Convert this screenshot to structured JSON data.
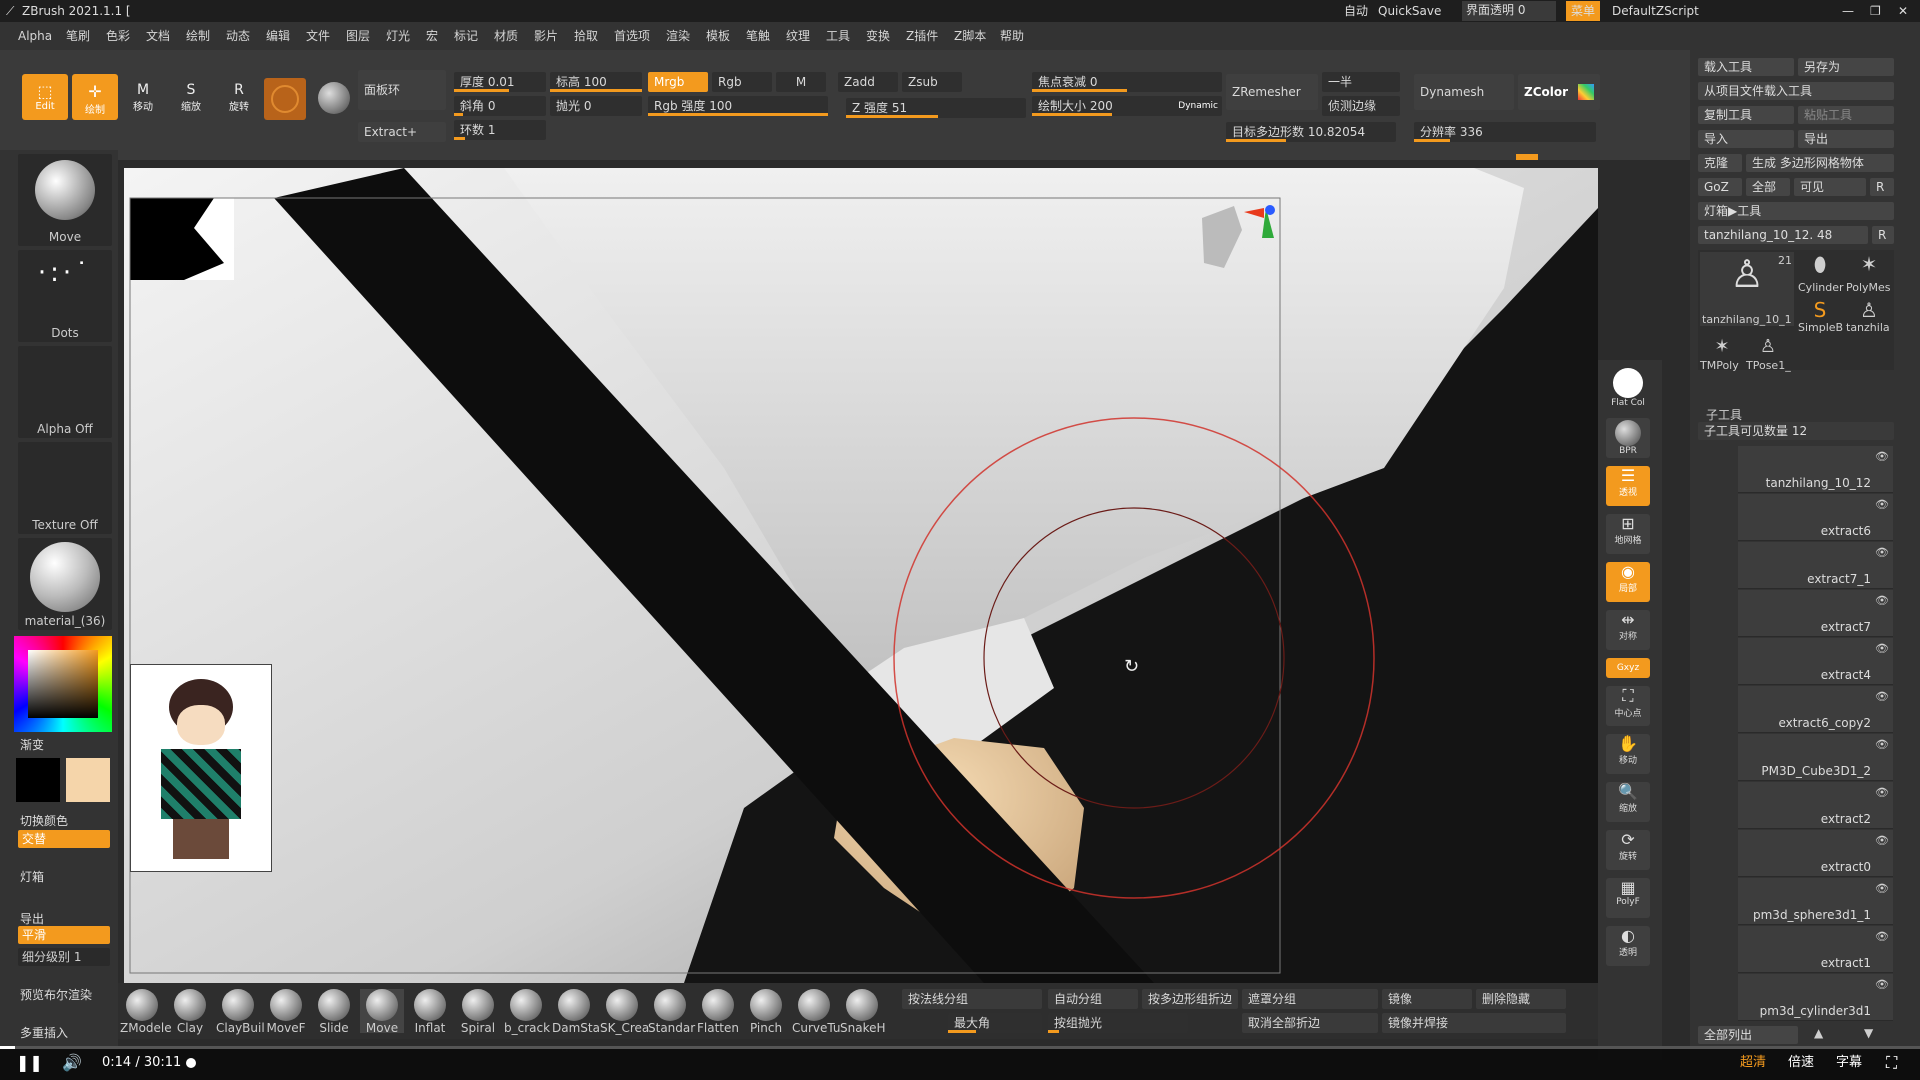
{
  "app": {
    "title": "ZBrush 2021.1.1 [",
    "top_right": {
      "auto": "自动",
      "quicksave": "QuickSave",
      "ui_transparency": "界面透明 0",
      "menus": "菜单",
      "script": "DefaultZScript"
    }
  },
  "menu": [
    "Alpha",
    "笔刷",
    "色彩",
    "文档",
    "绘制",
    "动态",
    "编辑",
    "文件",
    "图层",
    "灯光",
    "宏",
    "标记",
    "材质",
    "影片",
    "拾取",
    "首选项",
    "渲染",
    "模板",
    "笔触",
    "纹理",
    "工具",
    "变换",
    "Z插件",
    "Z脚本",
    "帮助"
  ],
  "toolbar": {
    "edit": "Edit",
    "draw": "绘制",
    "move": "移动",
    "scale": "缩放",
    "rotate": "旋转",
    "panel_loops": "面板环",
    "extract": "Extract+",
    "thickness": "厚度 0.01",
    "bevel": "斜角 0",
    "loops": "环数 1",
    "elevation": "标高 100",
    "polish": "抛光 0",
    "mrgb": "Mrgb",
    "rgb": "Rgb",
    "m": "M",
    "rgb_intensity": "Rgb 强度 100",
    "zadd": "Zadd",
    "zsub": "Zsub",
    "z_intensity": "Z 强度 51",
    "focal_shift": "焦点衰减 0",
    "draw_size": "绘制大小 200",
    "dynamic": "Dynamic",
    "zremesher": "ZRemesher",
    "half": "一半",
    "detect_edges": "侦测边缘",
    "target_poly": "目标多边形数 10.82054",
    "dynamesh": "Dynamesh",
    "resolution": "分辨率 336",
    "zcolor": "ZColor"
  },
  "left": {
    "brush": "Move",
    "stroke": "Dots",
    "alpha": "Alpha Off",
    "texture": "Texture Off",
    "material": "material_(36)",
    "gradient": "渐变",
    "switch_color": "切换颜色",
    "alternate": "交替",
    "lightbox": "灯箱",
    "export": "导出",
    "smooth": "平滑",
    "subdiv": "细分级别 1",
    "preview_bool": "预览布尔渲染",
    "multi_insert": "多重插入"
  },
  "colors": {
    "accent": "#f39a1e",
    "secondary": "#f5d5aa",
    "main": "#111111"
  },
  "shelf": [
    {
      "label": "Flat Col",
      "icon": "white-sphere-icon"
    },
    {
      "label": "BPR",
      "icon": "bpr-icon"
    },
    {
      "label": "透视",
      "icon": "perspective-icon",
      "on": true
    },
    {
      "label": "地网格",
      "icon": "floor-icon"
    },
    {
      "label": "局部",
      "icon": "local-icon",
      "on": true
    },
    {
      "label": "对称",
      "icon": "symmetry-icon"
    },
    {
      "label": "Gxyz",
      "icon": "xyz-icon",
      "on": true
    },
    {
      "label": "中心点",
      "icon": "frame-icon"
    },
    {
      "label": "移动",
      "icon": "move-icon"
    },
    {
      "label": "缩放",
      "icon": "zoom-icon"
    },
    {
      "label": "旋转",
      "icon": "rotate-icon"
    },
    {
      "label": "PolyF",
      "icon": "polyframe-icon"
    },
    {
      "label": "透明",
      "icon": "transparency-icon"
    }
  ],
  "right": {
    "load_tool": "载入工具",
    "save_as": "另存为",
    "load_from_project": "从项目文件载入工具",
    "copy_tool": "复制工具",
    "paste_tool": "粘贴工具",
    "import": "导入",
    "export": "导出",
    "clone": "克隆",
    "make_polymesh": "生成 多边形网格物体",
    "goz": "GoZ",
    "all": "全部",
    "visible": "可见",
    "r": "R",
    "lightbox_tools": "灯箱▶工具",
    "current_tool": "tanzhilang_10_12. 48",
    "tools": [
      "tanzhilang_10_1",
      "Cylinder",
      "PolyMes",
      "SimpleB",
      "tanzhila",
      "TMPoly",
      "TPose1_"
    ],
    "tool_count": "21",
    "subtool_title": "子工具",
    "subtool_visible": "子工具可见数量 12",
    "subtools": [
      "tanzhilang_10_12",
      "extract6",
      "extract7_1",
      "extract7",
      "extract4",
      "extract6_copy2",
      "PM3D_Cube3D1_2",
      "extract2",
      "extract0",
      "pm3d_sphere3d1_1",
      "extract1",
      "pm3d_cylinder3d1"
    ],
    "list_all": "全部列出"
  },
  "bottom": {
    "brushes": [
      "ZModele",
      "Clay",
      "ClayBuil",
      "MoveF",
      "Slide",
      "Move",
      "Inflat",
      "Spiral",
      "b_crack",
      "DamSta",
      "SK_Crea",
      "Standar",
      "Flatten",
      "Pinch",
      "CurveTu",
      "SnakeH"
    ],
    "group_normals": "按法线分组",
    "auto_groups": "自动分组",
    "group_by_crease": "按多边形组折边",
    "group_mask": "遮罩分组",
    "mirror": "镜像",
    "delete_hidden": "删除隐藏",
    "max_angle": "最大角",
    "polish_groups": "按组抛光",
    "uncrease_all": "取消全部折边",
    "mirror_weld": "镜像并焊接"
  },
  "video": {
    "time": "0:14 / 30:11",
    "quality": "超清",
    "speed": "倍速",
    "subtitle": "字幕",
    "progress": 0.008
  }
}
